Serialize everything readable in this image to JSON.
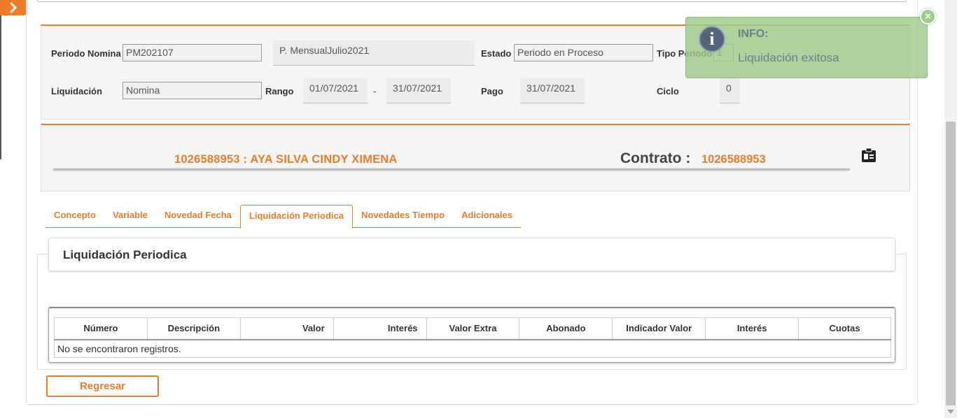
{
  "form": {
    "periodo_nomina_label": "Periodo Nomina",
    "periodo_nomina_value": "PM202107",
    "periodo_desc": "P. MensualJulio2021",
    "estado_label": "Estado",
    "estado_value": "Periodo en Proceso",
    "tipo_periodo_label": "Tipo Periodo",
    "tipo_periodo_value": "1",
    "liquidacion_label": "Liquidación",
    "liquidacion_value": "Nomina",
    "rango_label": "Rango",
    "rango_desde": "01/07/2021",
    "rango_sep": "-",
    "rango_hasta": "31/07/2021",
    "pago_label": "Pago",
    "pago_value": "31/07/2021",
    "ciclo_label": "Ciclo",
    "ciclo_value": "0"
  },
  "employee": {
    "name": "1026588953 : AYA SILVA CINDY XIMENA",
    "contrato_label": "Contrato :",
    "contrato_value": "1026588953"
  },
  "tabs": [
    {
      "label": "Concepto"
    },
    {
      "label": "Variable"
    },
    {
      "label": "Novedad Fecha"
    },
    {
      "label": "Liquidación Periodica"
    },
    {
      "label": "Novedades Tiempo"
    },
    {
      "label": "Adicionales"
    }
  ],
  "panel": {
    "title": "Liquidación Periodica",
    "columns": [
      "Número",
      "Descripción",
      "Valor",
      "Interés",
      "Valor Extra",
      "Abonado",
      "Indicador Valor",
      "Interés",
      "Cuotas"
    ],
    "empty_message": "No se encontraron registros."
  },
  "buttons": {
    "back": "Regresar"
  },
  "toast": {
    "title": "INFO:",
    "message": "Liquidación exitosa"
  },
  "icons": {
    "sidebar_toggle": "chevron-right-icon",
    "contract_card": "id-card-icon",
    "toast_info": "info-icon",
    "toast_close": "close-icon"
  },
  "colors": {
    "accent": "#f07c28",
    "toast_bg": "#9ccc89",
    "panel_bg": "#f5f5f5"
  }
}
